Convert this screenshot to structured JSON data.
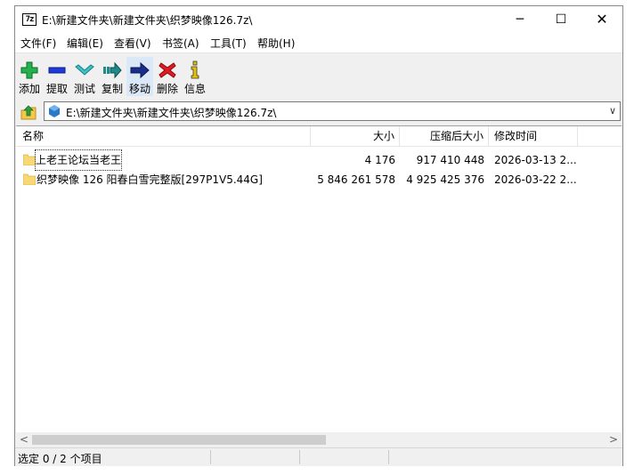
{
  "window": {
    "app_icon_text": "7z",
    "title": "E:\\新建文件夹\\新建文件夹\\织梦映像126.7z\\",
    "minimize_glyph": "─",
    "maximize_glyph": "☐",
    "close_glyph": "✕"
  },
  "menu": [
    {
      "label": "文件(F)"
    },
    {
      "label": "编辑(E)"
    },
    {
      "label": "查看(V)"
    },
    {
      "label": "书签(A)"
    },
    {
      "label": "工具(T)"
    },
    {
      "label": "帮助(H)"
    }
  ],
  "toolbar": [
    {
      "label": "添加",
      "icon": "add-icon",
      "color": "#22b14c"
    },
    {
      "label": "提取",
      "icon": "extract-icon",
      "color": "#1f3ad6"
    },
    {
      "label": "测试",
      "icon": "test-icon",
      "color": "#3cc2c8"
    },
    {
      "label": "复制",
      "icon": "copy-icon",
      "color": "#1f8a8a"
    },
    {
      "label": "移动",
      "icon": "move-icon",
      "color": "#1a2d8c"
    },
    {
      "label": "删除",
      "icon": "delete-icon",
      "color": "#e01b24"
    },
    {
      "label": "信息",
      "icon": "info-icon",
      "color": "#e8c400"
    }
  ],
  "address": {
    "path": "E:\\新建文件夹\\新建文件夹\\织梦映像126.7z\\",
    "dropdown_glyph": "∨"
  },
  "list": {
    "columns": [
      "名称",
      "大小",
      "压缩后大小",
      "修改时间"
    ],
    "rows": [
      {
        "name": "上老王论坛当老王",
        "size": "4 176",
        "packed": "917 410 448",
        "modified": "2026-03-13 2..."
      },
      {
        "name": "织梦映像 126 阳春白雪完整版[297P1V5.44G]",
        "size": "5 846 261 578",
        "packed": "4 925 425 376",
        "modified": "2026-03-22 2..."
      }
    ]
  },
  "scrollbar": {
    "left_glyph": "<",
    "right_glyph": ">"
  },
  "status": {
    "text": "选定 0 / 2 个项目"
  }
}
